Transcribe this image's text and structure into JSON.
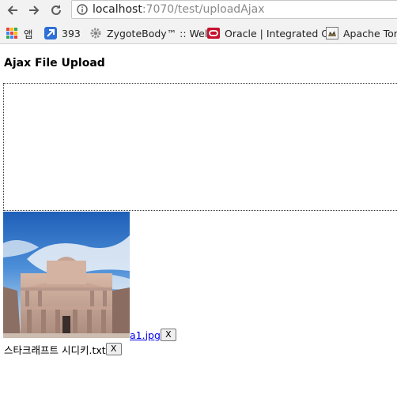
{
  "browser": {
    "url_host": "localhost",
    "url_rest": ":7070/test/uploadAjax",
    "bookmarks": [
      {
        "label": "앱",
        "icon": "apps-grid-icon"
      },
      {
        "label": "393",
        "icon": "blue-app-icon"
      },
      {
        "label": "ZygoteBody™ :: Wel",
        "icon": "gear-icon"
      },
      {
        "label": "Oracle | Integrated C",
        "icon": "oracle-icon"
      },
      {
        "label": "Apache Tom",
        "icon": "tomcat-icon"
      }
    ]
  },
  "page": {
    "title": "Ajax File Upload"
  },
  "files": [
    {
      "name": "a1.jpg",
      "is_image": true,
      "remove_label": "X"
    },
    {
      "name": "스타크래프트 시디키.txt",
      "is_image": false,
      "remove_label": "X"
    }
  ],
  "colors": {
    "link": "#0000ee",
    "chrome_bg": "#f2f2f2"
  }
}
